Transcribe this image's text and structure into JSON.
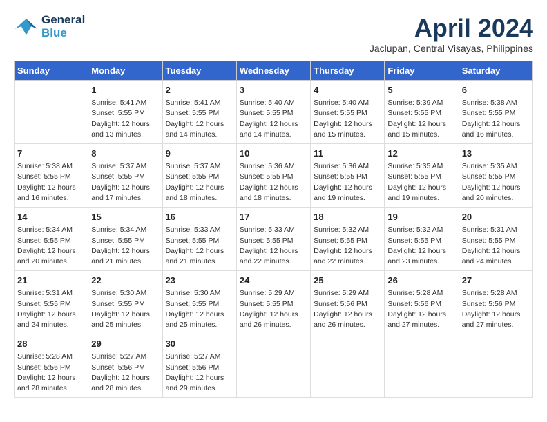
{
  "header": {
    "logo_line1": "General",
    "logo_line2": "Blue",
    "month": "April 2024",
    "location": "Jaclupan, Central Visayas, Philippines"
  },
  "weekdays": [
    "Sunday",
    "Monday",
    "Tuesday",
    "Wednesday",
    "Thursday",
    "Friday",
    "Saturday"
  ],
  "weeks": [
    [
      {
        "day": "",
        "info": ""
      },
      {
        "day": "1",
        "info": "Sunrise: 5:41 AM\nSunset: 5:55 PM\nDaylight: 12 hours\nand 13 minutes."
      },
      {
        "day": "2",
        "info": "Sunrise: 5:41 AM\nSunset: 5:55 PM\nDaylight: 12 hours\nand 14 minutes."
      },
      {
        "day": "3",
        "info": "Sunrise: 5:40 AM\nSunset: 5:55 PM\nDaylight: 12 hours\nand 14 minutes."
      },
      {
        "day": "4",
        "info": "Sunrise: 5:40 AM\nSunset: 5:55 PM\nDaylight: 12 hours\nand 15 minutes."
      },
      {
        "day": "5",
        "info": "Sunrise: 5:39 AM\nSunset: 5:55 PM\nDaylight: 12 hours\nand 15 minutes."
      },
      {
        "day": "6",
        "info": "Sunrise: 5:38 AM\nSunset: 5:55 PM\nDaylight: 12 hours\nand 16 minutes."
      }
    ],
    [
      {
        "day": "7",
        "info": "Sunrise: 5:38 AM\nSunset: 5:55 PM\nDaylight: 12 hours\nand 16 minutes."
      },
      {
        "day": "8",
        "info": "Sunrise: 5:37 AM\nSunset: 5:55 PM\nDaylight: 12 hours\nand 17 minutes."
      },
      {
        "day": "9",
        "info": "Sunrise: 5:37 AM\nSunset: 5:55 PM\nDaylight: 12 hours\nand 18 minutes."
      },
      {
        "day": "10",
        "info": "Sunrise: 5:36 AM\nSunset: 5:55 PM\nDaylight: 12 hours\nand 18 minutes."
      },
      {
        "day": "11",
        "info": "Sunrise: 5:36 AM\nSunset: 5:55 PM\nDaylight: 12 hours\nand 19 minutes."
      },
      {
        "day": "12",
        "info": "Sunrise: 5:35 AM\nSunset: 5:55 PM\nDaylight: 12 hours\nand 19 minutes."
      },
      {
        "day": "13",
        "info": "Sunrise: 5:35 AM\nSunset: 5:55 PM\nDaylight: 12 hours\nand 20 minutes."
      }
    ],
    [
      {
        "day": "14",
        "info": "Sunrise: 5:34 AM\nSunset: 5:55 PM\nDaylight: 12 hours\nand 20 minutes."
      },
      {
        "day": "15",
        "info": "Sunrise: 5:34 AM\nSunset: 5:55 PM\nDaylight: 12 hours\nand 21 minutes."
      },
      {
        "day": "16",
        "info": "Sunrise: 5:33 AM\nSunset: 5:55 PM\nDaylight: 12 hours\nand 21 minutes."
      },
      {
        "day": "17",
        "info": "Sunrise: 5:33 AM\nSunset: 5:55 PM\nDaylight: 12 hours\nand 22 minutes."
      },
      {
        "day": "18",
        "info": "Sunrise: 5:32 AM\nSunset: 5:55 PM\nDaylight: 12 hours\nand 22 minutes."
      },
      {
        "day": "19",
        "info": "Sunrise: 5:32 AM\nSunset: 5:55 PM\nDaylight: 12 hours\nand 23 minutes."
      },
      {
        "day": "20",
        "info": "Sunrise: 5:31 AM\nSunset: 5:55 PM\nDaylight: 12 hours\nand 24 minutes."
      }
    ],
    [
      {
        "day": "21",
        "info": "Sunrise: 5:31 AM\nSunset: 5:55 PM\nDaylight: 12 hours\nand 24 minutes."
      },
      {
        "day": "22",
        "info": "Sunrise: 5:30 AM\nSunset: 5:55 PM\nDaylight: 12 hours\nand 25 minutes."
      },
      {
        "day": "23",
        "info": "Sunrise: 5:30 AM\nSunset: 5:55 PM\nDaylight: 12 hours\nand 25 minutes."
      },
      {
        "day": "24",
        "info": "Sunrise: 5:29 AM\nSunset: 5:55 PM\nDaylight: 12 hours\nand 26 minutes."
      },
      {
        "day": "25",
        "info": "Sunrise: 5:29 AM\nSunset: 5:56 PM\nDaylight: 12 hours\nand 26 minutes."
      },
      {
        "day": "26",
        "info": "Sunrise: 5:28 AM\nSunset: 5:56 PM\nDaylight: 12 hours\nand 27 minutes."
      },
      {
        "day": "27",
        "info": "Sunrise: 5:28 AM\nSunset: 5:56 PM\nDaylight: 12 hours\nand 27 minutes."
      }
    ],
    [
      {
        "day": "28",
        "info": "Sunrise: 5:28 AM\nSunset: 5:56 PM\nDaylight: 12 hours\nand 28 minutes."
      },
      {
        "day": "29",
        "info": "Sunrise: 5:27 AM\nSunset: 5:56 PM\nDaylight: 12 hours\nand 28 minutes."
      },
      {
        "day": "30",
        "info": "Sunrise: 5:27 AM\nSunset: 5:56 PM\nDaylight: 12 hours\nand 29 minutes."
      },
      {
        "day": "",
        "info": ""
      },
      {
        "day": "",
        "info": ""
      },
      {
        "day": "",
        "info": ""
      },
      {
        "day": "",
        "info": ""
      }
    ]
  ]
}
